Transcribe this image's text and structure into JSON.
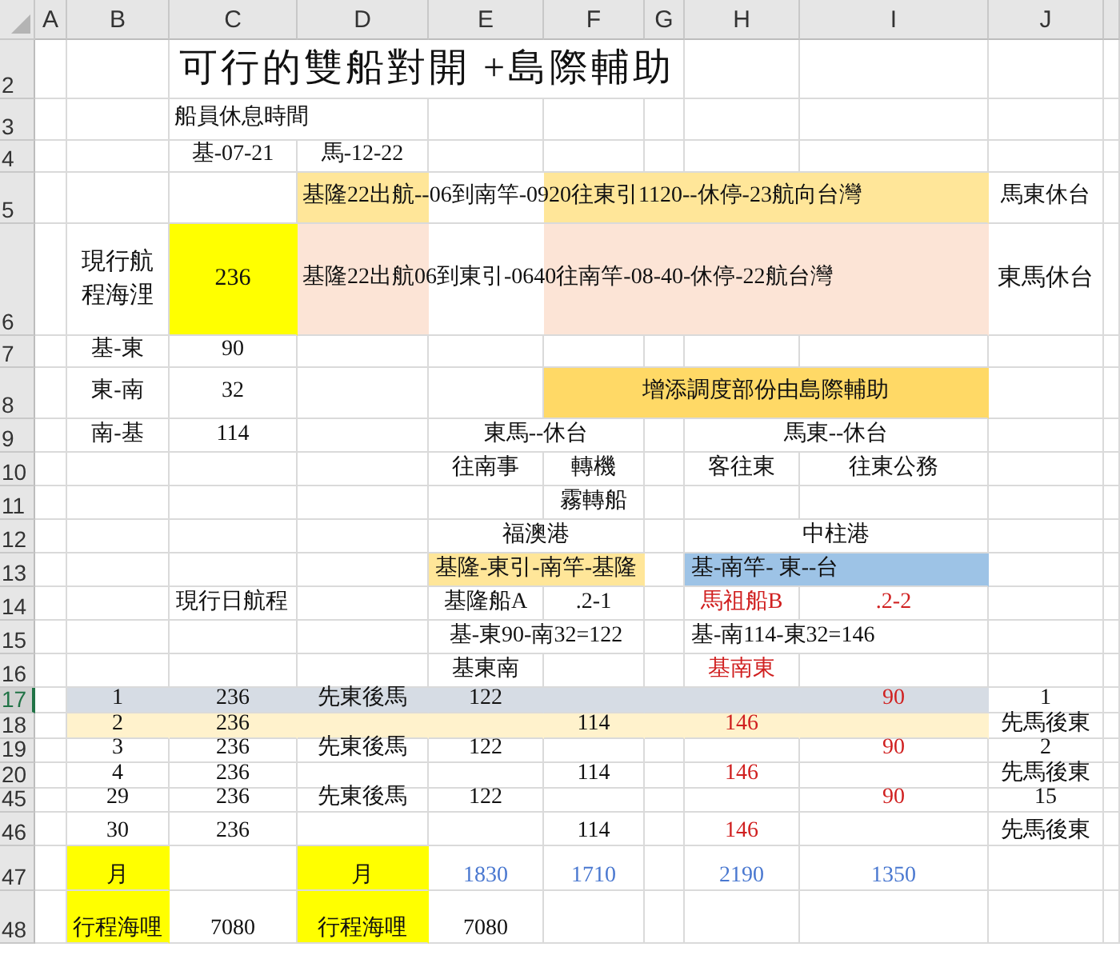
{
  "columns": [
    {
      "label": "A"
    },
    {
      "label": "B"
    },
    {
      "label": "C"
    },
    {
      "label": "D"
    },
    {
      "label": "E"
    },
    {
      "label": "F"
    },
    {
      "label": "G"
    },
    {
      "label": "H"
    },
    {
      "label": "I"
    },
    {
      "label": "J"
    }
  ],
  "rows": [
    {
      "label": "2",
      "selected": false,
      "cells": [
        {},
        {},
        {
          "kind": "title",
          "content": {
            "text": "可行的雙船對開 +島際輔助"
          }
        },
        {
          "kind": "covered"
        },
        {
          "kind": "covered"
        },
        {
          "kind": "covered"
        },
        {
          "kind": "covered"
        },
        {},
        {},
        {}
      ]
    },
    {
      "label": "3",
      "selected": false,
      "cells": [
        {},
        {},
        {
          "kind": "overflow",
          "content": {
            "text": "船員休息時間"
          }
        },
        {
          "kind": "spill"
        },
        {},
        {},
        {},
        {},
        {},
        {}
      ]
    },
    {
      "label": "4",
      "selected": false,
      "cells": [
        {},
        {},
        {
          "kind": "center",
          "content": {
            "text": "基-07-21"
          }
        },
        {
          "kind": "center",
          "content": {
            "text": "馬-12-22"
          }
        },
        {},
        {},
        {},
        {},
        {},
        {}
      ]
    },
    {
      "label": "5",
      "selected": false,
      "cells": [
        {},
        {},
        {},
        {
          "kind": "overflow",
          "content": {
            "text": "基隆22出航--06到南竿-0920往東引1120--休停-23航向台灣"
          },
          "color": "#ffe699"
        },
        {
          "kind": "spill"
        },
        {
          "kind": "spill",
          "color": "#ffe699"
        },
        {
          "kind": "covered"
        },
        {
          "kind": "covered"
        },
        {
          "kind": "covered"
        },
        {
          "kind": "center",
          "content": {
            "text": "馬東休台"
          }
        }
      ]
    },
    {
      "label": "6",
      "selected": false,
      "cells": [
        {},
        {
          "kind": "center",
          "content": {
            "text": "現行航程海浬"
          }
        },
        {
          "kind": "center",
          "content": {
            "text": "236"
          },
          "color": "#ffff00"
        },
        {
          "kind": "overflow",
          "content": {
            "text": "基隆22出航06到東引-0640往南竿-08-40-休停-22航台灣"
          },
          "color": "#fce4d6"
        },
        {
          "kind": "spill"
        },
        {
          "kind": "spill",
          "color": "#fce4d6"
        },
        {
          "kind": "covered"
        },
        {
          "kind": "covered"
        },
        {
          "kind": "covered"
        },
        {
          "kind": "center",
          "content": {
            "text": "東馬休台"
          }
        }
      ]
    },
    {
      "label": "7",
      "selected": false,
      "cells": [
        {},
        {
          "kind": "center",
          "content": {
            "text": "基-東"
          }
        },
        {
          "kind": "center",
          "content": {
            "text": "90"
          }
        },
        {},
        {},
        {},
        {},
        {},
        {},
        {}
      ]
    },
    {
      "label": "8",
      "selected": false,
      "cells": [
        {},
        {
          "kind": "center",
          "content": {
            "text": "東-南"
          }
        },
        {
          "kind": "center",
          "content": {
            "text": "32"
          }
        },
        {},
        {},
        {
          "kind": "center",
          "content": {
            "text": "增添調度部份由島際輔助"
          },
          "color": "#ffd966"
        },
        {
          "kind": "covered"
        },
        {
          "kind": "covered"
        },
        {
          "kind": "covered"
        },
        {}
      ]
    },
    {
      "label": "9",
      "selected": false,
      "cells": [
        {},
        {
          "kind": "center",
          "content": {
            "text": "南-基"
          }
        },
        {
          "kind": "center",
          "content": {
            "text": "114"
          }
        },
        {},
        {
          "kind": "center",
          "content": {
            "text": "東馬--休台"
          }
        },
        {
          "kind": "covered"
        },
        {},
        {
          "kind": "center",
          "content": {
            "text": "馬東--休台"
          }
        },
        {
          "kind": "covered"
        },
        {}
      ]
    },
    {
      "label": "10",
      "selected": false,
      "cells": [
        {},
        {},
        {},
        {},
        {
          "kind": "center",
          "content": {
            "text": "往南事"
          }
        },
        {
          "kind": "center",
          "content": {
            "text": "轉機"
          }
        },
        {},
        {
          "kind": "center",
          "content": {
            "text": "客往東"
          }
        },
        {
          "kind": "center",
          "content": {
            "text": "往東公務"
          }
        },
        {}
      ]
    },
    {
      "label": "11",
      "selected": false,
      "cells": [
        {},
        {},
        {},
        {},
        {},
        {
          "kind": "center",
          "content": {
            "text": "霧轉船"
          }
        },
        {},
        {},
        {},
        {}
      ]
    },
    {
      "label": "12",
      "selected": false,
      "cells": [
        {},
        {},
        {},
        {},
        {
          "kind": "center",
          "content": {
            "text": "福澳港"
          }
        },
        {
          "kind": "covered"
        },
        {},
        {
          "kind": "center",
          "content": {
            "text": "中柱港"
          }
        },
        {
          "kind": "covered"
        },
        {}
      ]
    },
    {
      "label": "13",
      "selected": false,
      "cells": [
        {},
        {},
        {},
        {},
        {
          "kind": "center",
          "content": {
            "text": "基隆-東引-南竿-基隆"
          },
          "color": "#ffe699"
        },
        {
          "kind": "covered"
        },
        {},
        {
          "kind": "left",
          "content": {
            "text": "基-南竿- 東--台"
          },
          "color": "#9dc3e6"
        },
        {
          "kind": "covered"
        },
        {}
      ]
    },
    {
      "label": "14",
      "selected": false,
      "cells": [
        {},
        {},
        {
          "kind": "left",
          "content": {
            "text": "現行日航程"
          }
        },
        {},
        {
          "kind": "center",
          "content": {
            "text": "基隆船A"
          }
        },
        {
          "kind": "center",
          "content": {
            "text": ".2-1"
          }
        },
        {},
        {
          "kind": "center",
          "content": {
            "text": "馬祖船B",
            "color": "#d02020"
          }
        },
        {
          "kind": "center",
          "content": {
            "text": ".2-2",
            "color": "#d02020"
          }
        },
        {}
      ]
    },
    {
      "label": "15",
      "selected": false,
      "cells": [
        {},
        {},
        {},
        {},
        {
          "kind": "center",
          "content": {
            "text": "基-東90-南32=122"
          }
        },
        {
          "kind": "covered"
        },
        {},
        {
          "kind": "left",
          "content": {
            "text": "基-南114-東32=146"
          }
        },
        {
          "kind": "covered"
        },
        {}
      ]
    },
    {
      "label": "16",
      "selected": false,
      "cells": [
        {},
        {},
        {},
        {},
        {
          "kind": "center",
          "content": {
            "text": "基東南"
          }
        },
        {},
        {},
        {
          "kind": "center",
          "content": {
            "text": "基南東",
            "color": "#d02020"
          }
        },
        {},
        {}
      ]
    },
    {
      "label": "17",
      "selected": true,
      "cells": [
        {},
        {
          "kind": "center",
          "content": {
            "text": "1"
          },
          "color": "#d6dce4"
        },
        {
          "kind": "center",
          "content": {
            "text": "236"
          },
          "color": "#d6dce4"
        },
        {
          "kind": "center",
          "content": {
            "text": "先東後馬"
          },
          "color": "#d6dce4"
        },
        {
          "kind": "center",
          "content": {
            "text": "122"
          },
          "color": "#d6dce4"
        },
        {
          "kind": "blank",
          "color": "#d6dce4"
        },
        {
          "kind": "blank",
          "color": "#d6dce4"
        },
        {
          "kind": "blank",
          "color": "#d6dce4"
        },
        {
          "kind": "center",
          "content": {
            "text": "90",
            "color": "#d02020"
          },
          "color": "#d6dce4"
        },
        {
          "kind": "center",
          "content": {
            "text": "1"
          }
        }
      ]
    },
    {
      "label": "18",
      "selected": false,
      "cells": [
        {},
        {
          "kind": "center",
          "content": {
            "text": "2"
          },
          "color": "#fff2cc"
        },
        {
          "kind": "center",
          "content": {
            "text": "236"
          },
          "color": "#fff2cc"
        },
        {
          "kind": "blank",
          "color": "#fff2cc"
        },
        {
          "kind": "blank",
          "color": "#fff2cc"
        },
        {
          "kind": "center",
          "content": {
            "text": "114"
          },
          "color": "#fff2cc"
        },
        {
          "kind": "blank",
          "color": "#fff2cc"
        },
        {
          "kind": "center",
          "content": {
            "text": "146",
            "color": "#d02020"
          },
          "color": "#fff2cc"
        },
        {
          "kind": "blank",
          "color": "#fff2cc"
        },
        {
          "kind": "center",
          "content": {
            "text": "先馬後東"
          }
        }
      ]
    },
    {
      "label": "19",
      "selected": false,
      "cells": [
        {},
        {
          "kind": "center",
          "content": {
            "text": "3"
          }
        },
        {
          "kind": "center",
          "content": {
            "text": "236"
          }
        },
        {
          "kind": "center",
          "content": {
            "text": "先東後馬"
          }
        },
        {
          "kind": "center",
          "content": {
            "text": "122"
          }
        },
        {},
        {},
        {},
        {
          "kind": "center",
          "content": {
            "text": "90",
            "color": "#d02020"
          }
        },
        {
          "kind": "center",
          "content": {
            "text": "2"
          }
        }
      ]
    },
    {
      "label": "20",
      "selected": false,
      "cells": [
        {},
        {
          "kind": "center",
          "content": {
            "text": "4"
          }
        },
        {
          "kind": "center",
          "content": {
            "text": "236"
          }
        },
        {},
        {},
        {
          "kind": "center",
          "content": {
            "text": "114"
          }
        },
        {},
        {
          "kind": "center",
          "content": {
            "text": "146",
            "color": "#d02020"
          }
        },
        {},
        {
          "kind": "center",
          "content": {
            "text": "先馬後東"
          }
        }
      ]
    },
    {
      "label": "45",
      "selected": false,
      "cells": [
        {},
        {
          "kind": "center",
          "content": {
            "text": "29"
          }
        },
        {
          "kind": "center",
          "content": {
            "text": "236"
          }
        },
        {
          "kind": "center",
          "content": {
            "text": "先東後馬"
          }
        },
        {
          "kind": "center",
          "content": {
            "text": "122"
          }
        },
        {},
        {},
        {},
        {
          "kind": "center",
          "content": {
            "text": "90",
            "color": "#d02020"
          }
        },
        {
          "kind": "center",
          "content": {
            "text": "15"
          }
        }
      ]
    },
    {
      "label": "46",
      "selected": false,
      "cells": [
        {},
        {
          "kind": "center",
          "content": {
            "text": "30"
          }
        },
        {
          "kind": "center",
          "content": {
            "text": "236"
          }
        },
        {},
        {},
        {
          "kind": "center",
          "content": {
            "text": "114"
          }
        },
        {},
        {
          "kind": "center",
          "content": {
            "text": "146",
            "color": "#d02020"
          }
        },
        {},
        {
          "kind": "center",
          "content": {
            "text": "先馬後東"
          }
        }
      ]
    },
    {
      "label": "47",
      "selected": false,
      "cells": [
        {},
        {
          "kind": "center",
          "content": {
            "text": "月"
          },
          "color": "#ffff00"
        },
        {},
        {
          "kind": "center",
          "content": {
            "text": "月"
          },
          "color": "#ffff00"
        },
        {
          "kind": "center",
          "content": {
            "text": "1830",
            "color": "#4a78d0"
          }
        },
        {
          "kind": "center",
          "content": {
            "text": "1710",
            "color": "#4a78d0"
          }
        },
        {},
        {
          "kind": "center",
          "content": {
            "text": "2190",
            "color": "#4a78d0"
          }
        },
        {
          "kind": "center",
          "content": {
            "text": "1350",
            "color": "#4a78d0"
          }
        },
        {}
      ]
    },
    {
      "label": "48",
      "selected": false,
      "cells": [
        {},
        {
          "kind": "center",
          "content": {
            "text": "行程海哩"
          },
          "color": "#ffff00"
        },
        {
          "kind": "center",
          "content": {
            "text": "7080"
          }
        },
        {
          "kind": "center",
          "content": {
            "text": "行程海哩"
          },
          "color": "#ffff00"
        },
        {
          "kind": "center",
          "content": {
            "text": "7080"
          }
        },
        {},
        {},
        {},
        {},
        {}
      ]
    }
  ]
}
